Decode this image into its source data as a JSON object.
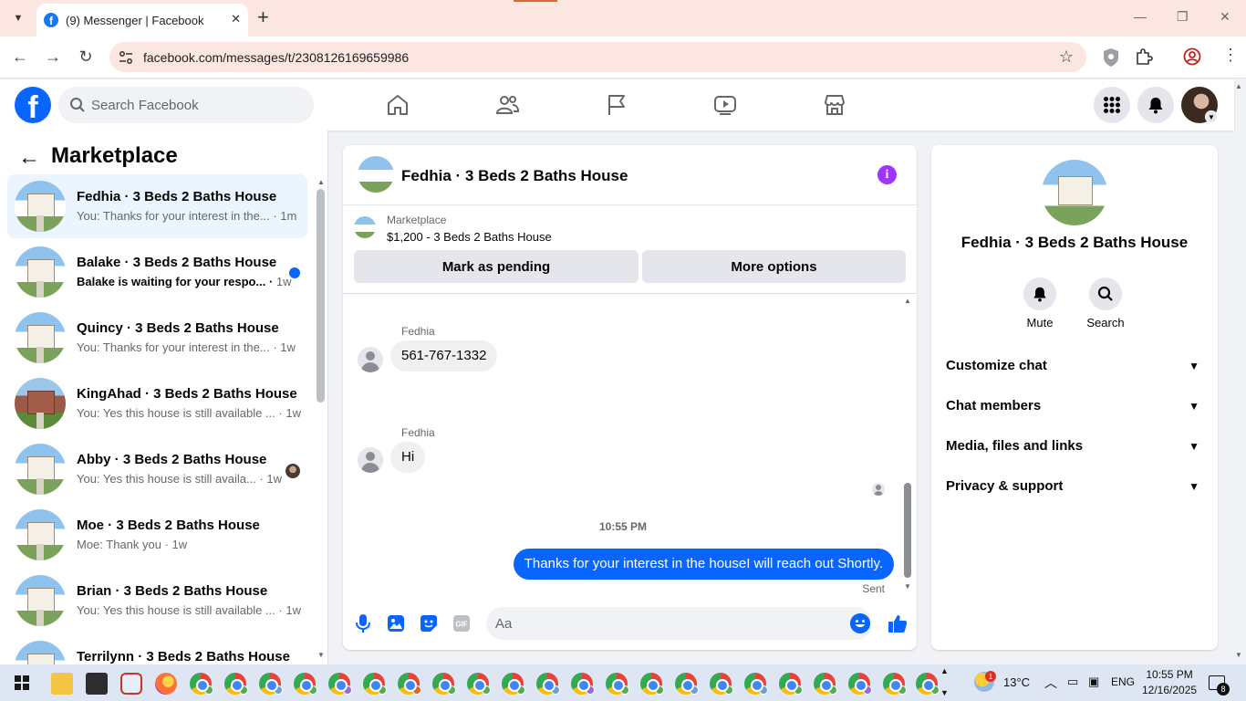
{
  "browser": {
    "tab_title": "(9) Messenger | Facebook",
    "url": "facebook.com/messages/t/2308126169659986"
  },
  "fb": {
    "search_placeholder": "Search Facebook"
  },
  "left": {
    "title": "Marketplace",
    "conversations": [
      {
        "name": "Fedhia · 3 Beds 2 Baths House",
        "preview": "You: Thanks for your interest in the...",
        "time": "1m",
        "active": true
      },
      {
        "name": "Balake · 3 Beds 2 Baths House",
        "preview": "Balake is waiting for your respo...",
        "time": "1w",
        "unread": true
      },
      {
        "name": "Quincy · 3 Beds 2 Baths House",
        "preview": "You: Thanks for your interest in the...",
        "time": "1w"
      },
      {
        "name": "KingAhad · 3 Beds 2 Baths House",
        "preview": "You: Yes this house is still available ...",
        "time": "1w"
      },
      {
        "name": "Abby · 3 Beds 2 Baths House",
        "preview": "You: Yes this house is still availa...",
        "time": "1w"
      },
      {
        "name": "Moe · 3 Beds 2 Baths House",
        "preview": "Moe: Thank you",
        "time": "1w"
      },
      {
        "name": "Brian · 3 Beds 2 Baths House",
        "preview": "You: Yes this house is still available ...",
        "time": "1w"
      },
      {
        "name": "Terrilynn · 3 Beds 2 Baths House",
        "preview": "",
        "time": ""
      }
    ]
  },
  "chat": {
    "title": "Fedhia · 3 Beds 2 Baths House",
    "marketplace_label": "Marketplace",
    "listing": "$1,200 - 3 Beds 2 Baths House",
    "btn_pending": "Mark as pending",
    "btn_more": "More options",
    "messages": [
      {
        "sender": "Fedhia",
        "text": "561-767-1332"
      },
      {
        "sender": "Fedhia",
        "text": "Hi"
      }
    ],
    "timestamp": "10:55 PM",
    "outgoing": "Thanks for your interest in the houseI will reach out Shortly.",
    "sent_label": "Sent",
    "composer_placeholder": "Aa"
  },
  "info": {
    "name": "Fedhia · 3 Beds 2 Baths House",
    "mute_label": "Mute",
    "search_label": "Search",
    "rows": [
      "Customize chat",
      "Chat members",
      "Media, files and links",
      "Privacy & support"
    ]
  },
  "taskbar": {
    "temperature": "13°C",
    "lang": "ENG",
    "time": "10:55 PM",
    "date": "12/16/2025",
    "notif_count": "8",
    "weather_badge": "1"
  },
  "colors": {
    "fb_blue": "#0866ff",
    "info_purple": "#a033ff",
    "active_row": "#ebf5ff"
  }
}
